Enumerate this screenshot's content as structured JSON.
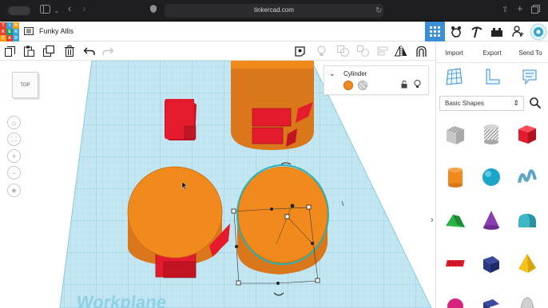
{
  "browser": {
    "url": "tinkercad.com"
  },
  "app": {
    "design_name": "Funky Allis",
    "logo_letters": [
      "T",
      "I",
      "N",
      "K",
      "E",
      "R",
      "C",
      "A",
      "D"
    ],
    "logo_colors": [
      "#e2432a",
      "#36a3d9",
      "#ff9a16",
      "#e2432a",
      "#1c9c6e",
      "#36a3d9",
      "#ff9a16",
      "#e2432a",
      "#36a3d9"
    ]
  },
  "panel": {
    "import_label": "Import",
    "export_label": "Export",
    "send_to_label": "Send To",
    "category": "Basic Shapes",
    "shapes": [
      "box-striped",
      "cylinder-striped",
      "box-red",
      "cylinder-orange",
      "sphere-blue",
      "scribble-blue",
      "roof-green",
      "cone-purple",
      "round-roof-teal",
      "text-red",
      "box-navy",
      "pyramid-yellow",
      "sphere-magenta",
      "box-navy-2",
      "paraboloid-gray"
    ]
  },
  "viewport": {
    "view_cube_label": "TOP",
    "workplane_label": "Workplane"
  },
  "inspector": {
    "title": "Cylinder",
    "color": "#f08a1c"
  },
  "colors": {
    "accent": "#3a8fd6",
    "shape_orange": "#f08a1c",
    "shape_red": "#e41b2c",
    "grid": "#bfe3ef"
  }
}
